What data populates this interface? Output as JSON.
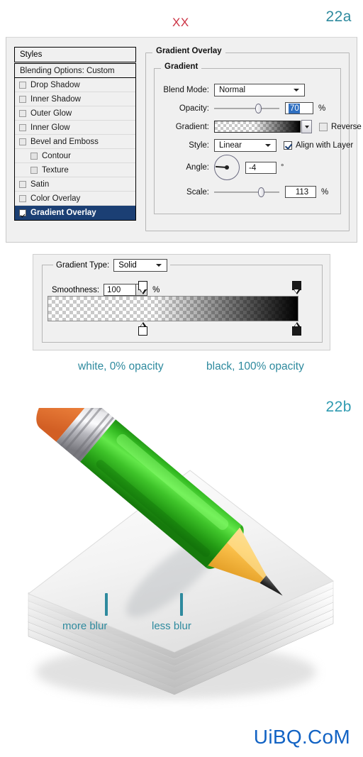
{
  "figures": {
    "label_a": "22a",
    "label_b": "22b",
    "xx_marker": "XX"
  },
  "colors": {
    "teal": "#2e8a9e",
    "red": "#cc3344",
    "blue_watermark": "#1263c4",
    "selected_row": "#1b3f74",
    "dialog_bg": "#f0f0f0"
  },
  "layer_style_dialog": {
    "styles_header": "Styles",
    "blending_options": "Blending Options: Custom",
    "style_items": [
      {
        "label": "Drop Shadow",
        "checked": false,
        "indent": false
      },
      {
        "label": "Inner Shadow",
        "checked": false,
        "indent": false
      },
      {
        "label": "Outer Glow",
        "checked": false,
        "indent": false
      },
      {
        "label": "Inner Glow",
        "checked": false,
        "indent": false
      },
      {
        "label": "Bevel and Emboss",
        "checked": false,
        "indent": false
      },
      {
        "label": "Contour",
        "checked": false,
        "indent": true
      },
      {
        "label": "Texture",
        "checked": false,
        "indent": true
      },
      {
        "label": "Satin",
        "checked": false,
        "indent": false
      },
      {
        "label": "Color Overlay",
        "checked": false,
        "indent": false
      },
      {
        "label": "Gradient Overlay",
        "checked": true,
        "indent": false,
        "selected": true
      }
    ],
    "panel": {
      "title": "Gradient Overlay",
      "group_title": "Gradient",
      "blend_mode_label": "Blend Mode:",
      "blend_mode_value": "Normal",
      "opacity_label": "Opacity:",
      "opacity_value": "70",
      "opacity_unit": "%",
      "gradient_label": "Gradient:",
      "reverse_label": "Reverse",
      "reverse_checked": false,
      "style_label": "Style:",
      "style_value": "Linear",
      "align_label": "Align with Layer",
      "align_checked": true,
      "angle_label": "Angle:",
      "angle_value": "-4",
      "angle_unit": "°",
      "scale_label": "Scale:",
      "scale_value": "113",
      "scale_unit": "%"
    }
  },
  "gradient_editor": {
    "type_label": "Gradient Type:",
    "type_value": "Solid",
    "smoothness_label": "Smoothness:",
    "smoothness_value": "100",
    "smoothness_unit": "%",
    "opacity_stops": [
      {
        "position_pct": 38,
        "color": "white"
      },
      {
        "position_pct": 100,
        "color": "black"
      }
    ],
    "color_stops": [
      {
        "position_pct": 38,
        "color": "white"
      },
      {
        "position_pct": 100,
        "color": "black"
      }
    ]
  },
  "captions": {
    "white_stop": "white, 0% opacity",
    "black_stop": "black, 100% opacity",
    "more_blur": "more blur",
    "less_blur": "less blur"
  },
  "illustration": {
    "name": "pencil-on-paper-stack",
    "pencil_eraser_color": "#ef7a3a",
    "pencil_body_color": "#3fc42a",
    "pencil_wood_color": "#f7c14a",
    "paper_color": "#f4f4f4"
  },
  "watermark": "UiBQ.CoM"
}
